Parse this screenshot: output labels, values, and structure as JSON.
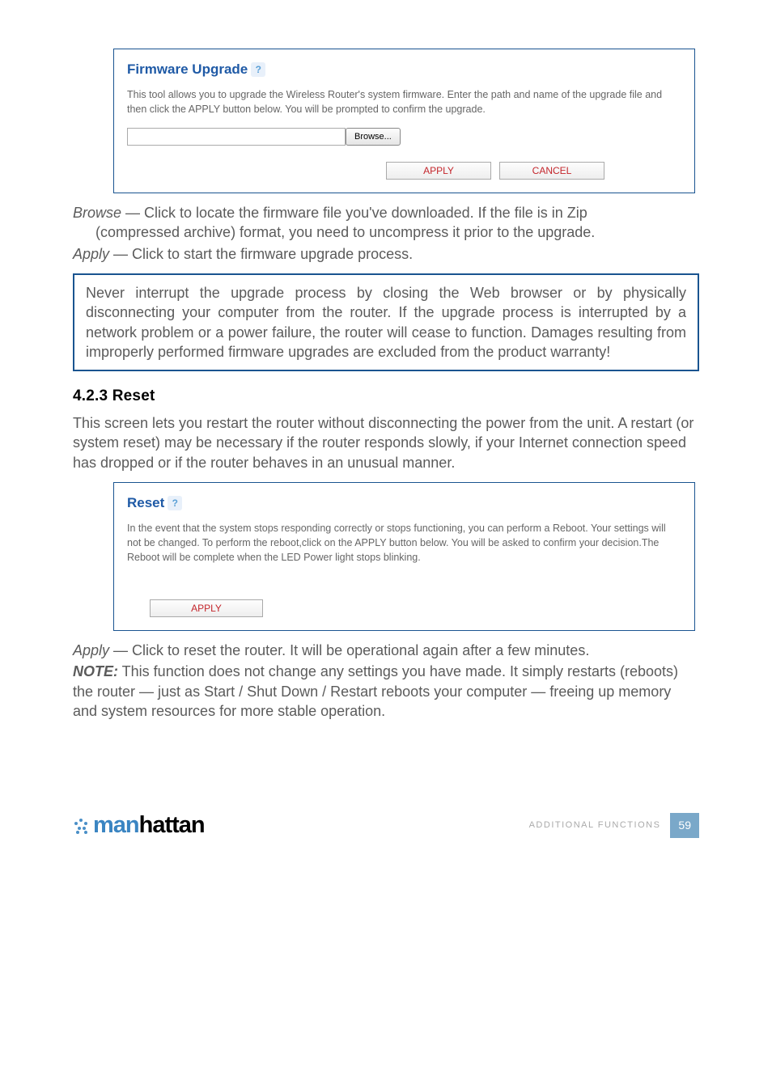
{
  "firmware": {
    "title": "Firmware Upgrade",
    "help_icon": "?",
    "description": "This tool allows you to upgrade the Wireless Router's system firmware. Enter the path and name of the upgrade file and then click the APPLY button below. You will be prompted to confirm the upgrade.",
    "browse_label": "Browse...",
    "apply_label": "APPLY",
    "cancel_label": "CANCEL"
  },
  "defs": {
    "browse_term": "Browse",
    "browse_line1": " — Click to locate the firmware file you've downloaded. If the file is in Zip",
    "browse_line2": "(compressed archive) format, you need to uncompress it prior to the upgrade.",
    "apply_term": "Apply",
    "apply_line": " — Click to start the firmware upgrade process."
  },
  "warning": "Never interrupt the upgrade process by closing the Web browser or by physically disconnecting your computer from the router. If the upgrade process is interrupted by a network problem or a power failure, the router will cease to function. Damages resulting from improperly performed firmware upgrades are excluded from the product warranty!",
  "reset": {
    "heading": "4.2.3  Reset",
    "intro": "This screen lets you restart the router without disconnecting the power from the unit. A restart (or system reset) may be necessary if the router responds slowly, if your Internet connection speed has dropped or if the router behaves in an unusual manner.",
    "title": "Reset",
    "help_icon": "?",
    "description": "In the event that the system stops responding correctly or stops functioning, you can perform a Reboot. Your settings will not be changed. To perform the reboot,click on the APPLY button below. You will be asked to confirm your decision.The Reboot will be complete when the LED Power light stops blinking.",
    "apply_label": "APPLY"
  },
  "post": {
    "apply_term": "Apply",
    "apply_line": " — Click to reset the router. It will be operational again after a few minutes.",
    "note_label": "NOTE:",
    "note_body": " This function does not change any settings you have made. It simply restarts (reboots) the router — just as Start / Shut Down / Restart reboots your computer — freeing up memory and system resources for more stable operation."
  },
  "footer": {
    "brand_prefix": "man",
    "brand_suffix": "hattan",
    "section": "ADDITIONAL FUNCTIONS",
    "page": "59"
  }
}
